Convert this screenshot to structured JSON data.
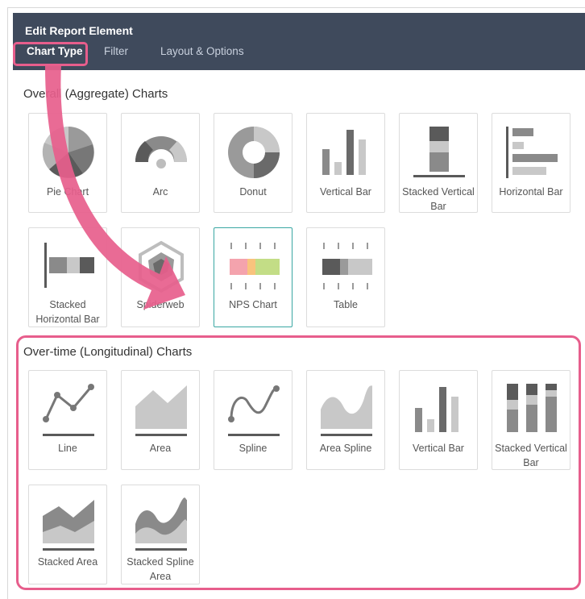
{
  "header": {
    "title": "Edit Report Element",
    "tabs": [
      {
        "label": "Chart Type",
        "active": true
      },
      {
        "label": "Filter",
        "active": false
      },
      {
        "label": "Layout & Options",
        "active": false
      }
    ]
  },
  "overall": {
    "title": "Overall (Aggregate) Charts",
    "tiles": [
      {
        "label": "Pie Chart",
        "icon": "pie-chart-icon"
      },
      {
        "label": "Arc",
        "icon": "arc-chart-icon"
      },
      {
        "label": "Donut",
        "icon": "donut-chart-icon"
      },
      {
        "label": "Vertical Bar",
        "icon": "vertical-bar-chart-icon"
      },
      {
        "label": "Stacked Vertical Bar",
        "icon": "stacked-vertical-bar-chart-icon"
      },
      {
        "label": "Horizontal Bar",
        "icon": "horizontal-bar-chart-icon"
      },
      {
        "label": "Stacked Horizontal Bar",
        "icon": "stacked-horizontal-bar-chart-icon"
      },
      {
        "label": "Spiderweb",
        "icon": "spiderweb-chart-icon"
      },
      {
        "label": "NPS Chart",
        "icon": "nps-chart-icon",
        "selected": true
      },
      {
        "label": "Table",
        "icon": "table-chart-icon"
      }
    ]
  },
  "overtime": {
    "title": "Over-time (Longitudinal) Charts",
    "tiles": [
      {
        "label": "Line",
        "icon": "line-chart-icon"
      },
      {
        "label": "Area",
        "icon": "area-chart-icon"
      },
      {
        "label": "Spline",
        "icon": "spline-chart-icon"
      },
      {
        "label": "Area Spline",
        "icon": "area-spline-chart-icon"
      },
      {
        "label": "Vertical Bar",
        "icon": "vertical-bar-chart-icon"
      },
      {
        "label": "Stacked Vertical Bar",
        "icon": "stacked-vertical-bar-chart-icon"
      },
      {
        "label": "Stacked Area",
        "icon": "stacked-area-chart-icon"
      },
      {
        "label": "Stacked Spline Area",
        "icon": "stacked-spline-area-chart-icon"
      }
    ]
  },
  "colors": {
    "header_bg": "#3f4a5c",
    "annotation": "#e75e8c",
    "selected_border": "#3aa7a3",
    "nps_red": "#f4a3ad",
    "nps_orange": "#f8c37d",
    "nps_green": "#c3dd86"
  }
}
